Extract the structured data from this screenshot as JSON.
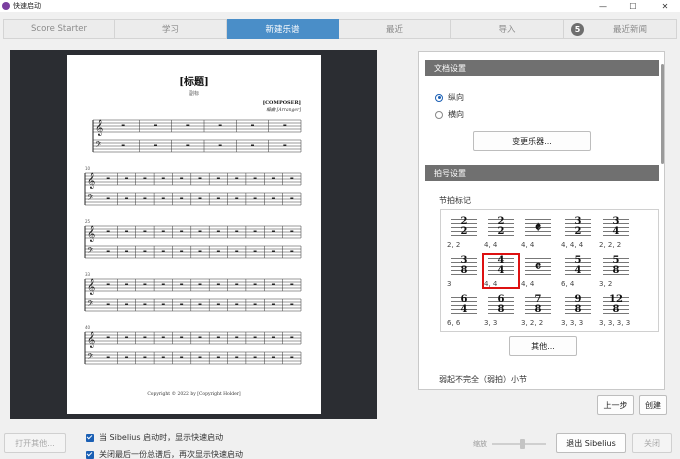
{
  "window": {
    "title": "快速启动",
    "minimize": "—",
    "maximize": "☐",
    "close": "✕"
  },
  "tabs": [
    {
      "label": "Score Starter"
    },
    {
      "label": "学习"
    },
    {
      "label": "新建乐谱"
    },
    {
      "label": "最近"
    },
    {
      "label": "导入"
    },
    {
      "label": "最近新闻",
      "badge": "5"
    }
  ],
  "score_preview": {
    "title": "[标题]",
    "subtitle": "副标",
    "composer": "[COMPOSER]",
    "arranger": "编曲 [Arranger]",
    "system_numbers": [
      "10",
      "25",
      "33",
      "40"
    ],
    "copyright": "Copyright © 2022 by [Copyright Holder]"
  },
  "doc_settings": {
    "header": "文档设置",
    "portrait": "纵向",
    "landscape": "横向",
    "change_instruments": "变更乐器..."
  },
  "time_sig": {
    "header": "拍号设置",
    "label": "节拍标记",
    "items": [
      {
        "top": "2",
        "bottom": "2",
        "caption": "2, 2"
      },
      {
        "top": "2",
        "bottom": "2",
        "caption": "4, 4"
      },
      {
        "symbol": "𝄵",
        "caption": "4, 4"
      },
      {
        "top": "3",
        "bottom": "2",
        "caption": "4, 4, 4"
      },
      {
        "top": "3",
        "bottom": "4",
        "caption": "2, 2, 2"
      },
      {
        "top": "3",
        "bottom": "8",
        "caption": "3"
      },
      {
        "top": "4",
        "bottom": "4",
        "caption": "4, 4"
      },
      {
        "symbol": "𝄴",
        "caption": "4, 4"
      },
      {
        "top": "5",
        "bottom": "4",
        "caption": "6, 4"
      },
      {
        "top": "5",
        "bottom": "8",
        "caption": "3, 2"
      },
      {
        "top": "6",
        "bottom": "4",
        "caption": "6, 6"
      },
      {
        "top": "6",
        "bottom": "8",
        "caption": "3, 3"
      },
      {
        "top": "7",
        "bottom": "8",
        "caption": "3, 2, 2"
      },
      {
        "top": "9",
        "bottom": "8",
        "caption": "3, 3, 3"
      },
      {
        "top": "12",
        "bottom": "8",
        "caption": "3, 3, 3, 3"
      }
    ],
    "other_button": "其他...",
    "pickup_label": "弱起不完全（弱拍）小节"
  },
  "footer": {
    "open_other": "打开其他...",
    "check1": "当 Sibelius 启动时，显示快速启动",
    "check2": "关闭最后一份总谱后，再次显示快速启动",
    "zoom_label": "缩放",
    "prev": "上一步",
    "create": "创建",
    "exit": "退出 Sibelius",
    "close": "关闭"
  }
}
